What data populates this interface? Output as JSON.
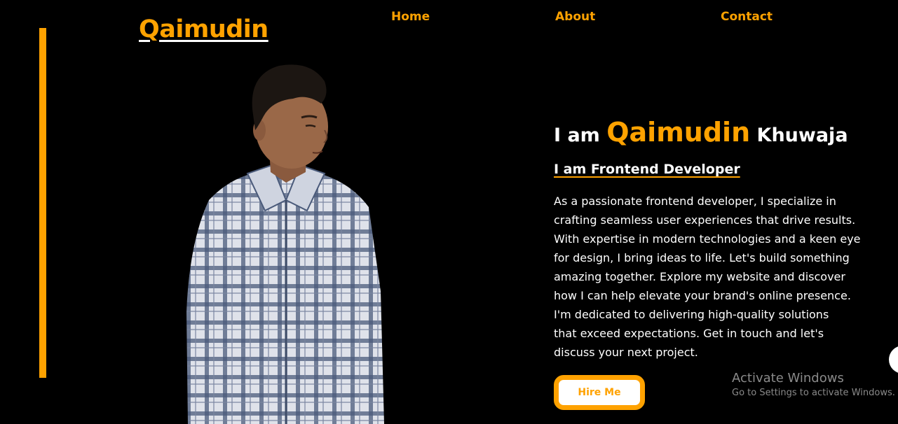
{
  "brand": {
    "logo_text": "Qaimudin"
  },
  "nav": {
    "items": [
      {
        "label": "Home"
      },
      {
        "label": "About"
      },
      {
        "label": "Contact"
      }
    ]
  },
  "hero": {
    "greeting": "I am",
    "first_name": "Qaimudin",
    "last_name": "Khuwaja",
    "subtitle": "I am Frontend Developer",
    "bio_lines": [
      "As a passionate frontend developer, I specialize in",
      "crafting seamless user experiences that drive results.",
      "With expertise in modern technologies and a keen eye",
      "for design, I bring ideas to life. Let's build something",
      "amazing together. Explore my website and discover",
      "how I can help elevate your brand's online presence.",
      "I'm dedicated to delivering high-quality solutions",
      "that exceed expectations. Get in touch and let's",
      "discuss your next project."
    ],
    "cta_label": "Hire Me"
  },
  "os_watermark": {
    "title": "Activate Windows",
    "subtitle": "Go to Settings to activate Windows."
  },
  "colors": {
    "accent": "#ffa200",
    "background": "#000000",
    "text": "#ffffff"
  }
}
